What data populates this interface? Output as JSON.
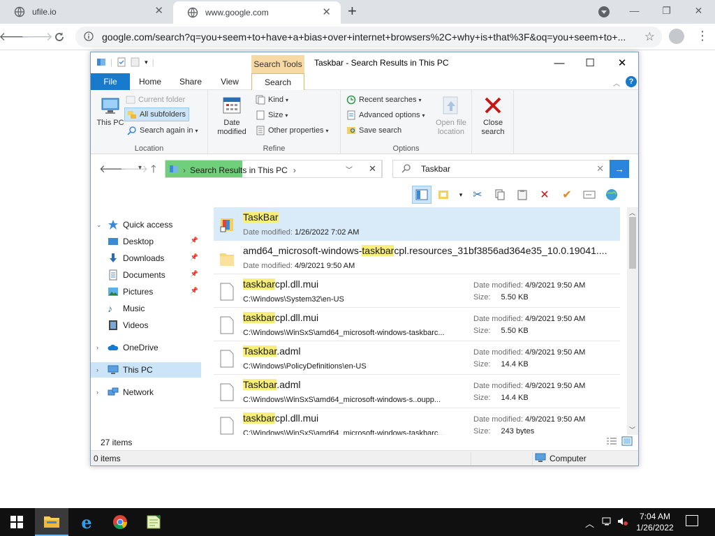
{
  "browser": {
    "tabs": [
      {
        "title": "ufile.io",
        "active": false
      },
      {
        "title": "www.google.com",
        "active": true
      }
    ],
    "url": "google.com/search?q=you+seem+to+have+a+bias+over+internet+browsers%2C+why+is+that%3F&oq=you+seem+to+..."
  },
  "explorer": {
    "title": "Taskbar - Search Results in This PC",
    "context_tab_header": "Search Tools",
    "ribbon_tabs": [
      "File",
      "Home",
      "Share",
      "View",
      "Search"
    ],
    "ribbon": {
      "location": {
        "label": "Location",
        "this_pc": "This PC",
        "current_folder": "Current folder",
        "all_subfolders": "All subfolders",
        "search_again_in": "Search again in"
      },
      "refine": {
        "label": "Refine",
        "date_modified": "Date modified",
        "kind": "Kind",
        "size": "Size",
        "other_properties": "Other properties"
      },
      "options": {
        "label": "Options",
        "recent_searches": "Recent searches",
        "advanced_options": "Advanced options",
        "save_search": "Save search",
        "open_file_location": "Open file location",
        "close_search": "Close search"
      }
    },
    "address": "Search Results in This PC",
    "search_query": "Taskbar",
    "nav": {
      "quick_access": "Quick access",
      "items": [
        {
          "label": "Desktop",
          "pinned": true
        },
        {
          "label": "Downloads",
          "pinned": true
        },
        {
          "label": "Documents",
          "pinned": true
        },
        {
          "label": "Pictures",
          "pinned": true
        },
        {
          "label": "Music",
          "pinned": false
        },
        {
          "label": "Videos",
          "pinned": false
        }
      ],
      "onedrive": "OneDrive",
      "this_pc": "This PC",
      "network": "Network"
    },
    "results": [
      {
        "pre": "",
        "hl": "TaskBar",
        "post": "",
        "sub_label": "Date modified:",
        "sub_value": "1/26/2022 7:02 AM",
        "type": "shortcut"
      },
      {
        "pre": "amd64_microsoft-windows-",
        "hl": "taskbar",
        "post": "cpl.resources_31bf3856ad364e35_10.0.19041....",
        "sub_label": "Date modified:",
        "sub_value": "4/9/2021 9:50 AM",
        "type": "folder"
      },
      {
        "pre": "",
        "hl": "taskbar",
        "post": "cpl.dll.mui",
        "path": "C:\\Windows\\System32\\en-US",
        "date": "4/9/2021 9:50 AM",
        "size": "5.50 KB",
        "type": "file"
      },
      {
        "pre": "",
        "hl": "taskbar",
        "post": "cpl.dll.mui",
        "path": "C:\\Windows\\WinSxS\\amd64_microsoft-windows-taskbarc...",
        "date": "4/9/2021 9:50 AM",
        "size": "5.50 KB",
        "type": "file"
      },
      {
        "pre": "",
        "hl": "Taskbar",
        "post": ".adml",
        "path": "C:\\Windows\\PolicyDefinitions\\en-US",
        "date": "4/9/2021 9:50 AM",
        "size": "14.4 KB",
        "type": "file"
      },
      {
        "pre": "",
        "hl": "Taskbar",
        "post": ".adml",
        "path": "C:\\Windows\\WinSxS\\amd64_microsoft-windows-s..oupp...",
        "date": "4/9/2021 9:50 AM",
        "size": "14.4 KB",
        "type": "file"
      },
      {
        "pre": "",
        "hl": "taskbar",
        "post": "cpl.dll.mui",
        "path": "C:\\Windows\\WinSxS\\amd64_microsoft-windows-taskbarc...",
        "date": "4/9/2021 9:50 AM",
        "size": "243 bytes",
        "type": "file"
      }
    ],
    "labels": {
      "date_modified": "Date modified:",
      "size": "Size:"
    },
    "item_count": "27 items",
    "selected_count": "0 items",
    "status_location": "Computer"
  },
  "taskbar": {
    "time": "7:04 AM",
    "date": "1/26/2022"
  },
  "colors": {
    "accent": "#1979ca",
    "highlight": "#f9ef77",
    "progress_green": "#6fcf7b"
  }
}
